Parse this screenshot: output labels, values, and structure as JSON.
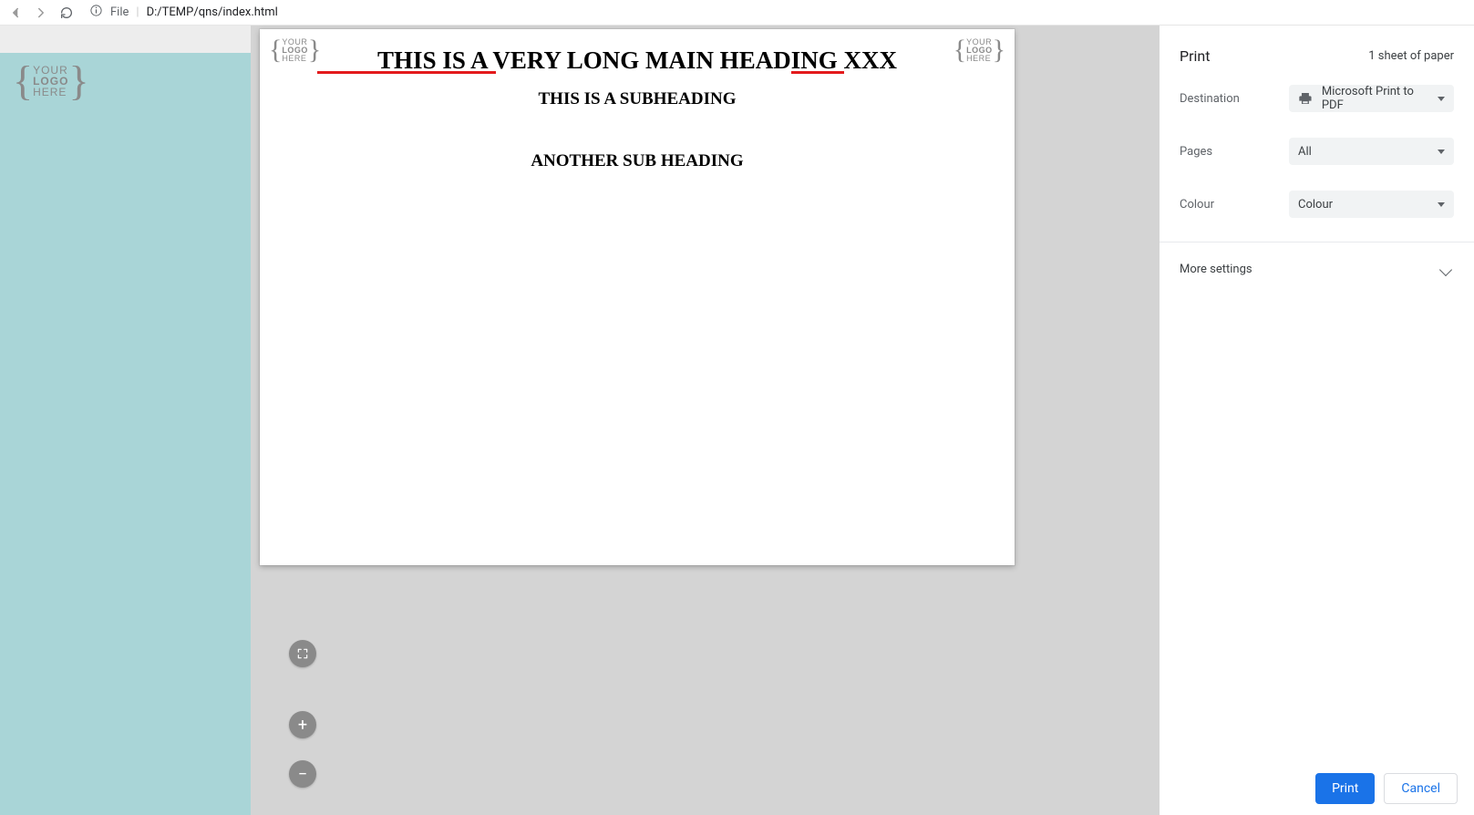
{
  "browser": {
    "file_label": "File",
    "url": "D:/TEMP/qns/index.html"
  },
  "page": {
    "logo_lines": [
      "YOUR",
      "LOGO",
      "HERE"
    ],
    "main_heading": "THIS IS A VERY LONG MAIN HEADING XXX",
    "sub_heading": "THIS IS A SUBHEADING",
    "sub_heading2": "ANOTHER SUB HEADING"
  },
  "print": {
    "title": "Print",
    "sheet_count": "1 sheet of paper",
    "rows": {
      "destination_label": "Destination",
      "destination_value": "Microsoft Print to PDF",
      "pages_label": "Pages",
      "pages_value": "All",
      "colour_label": "Colour",
      "colour_value": "Colour"
    },
    "more_settings": "More settings",
    "print_btn": "Print",
    "cancel_btn": "Cancel"
  },
  "zoom": {
    "plus": "+",
    "minus": "−"
  }
}
